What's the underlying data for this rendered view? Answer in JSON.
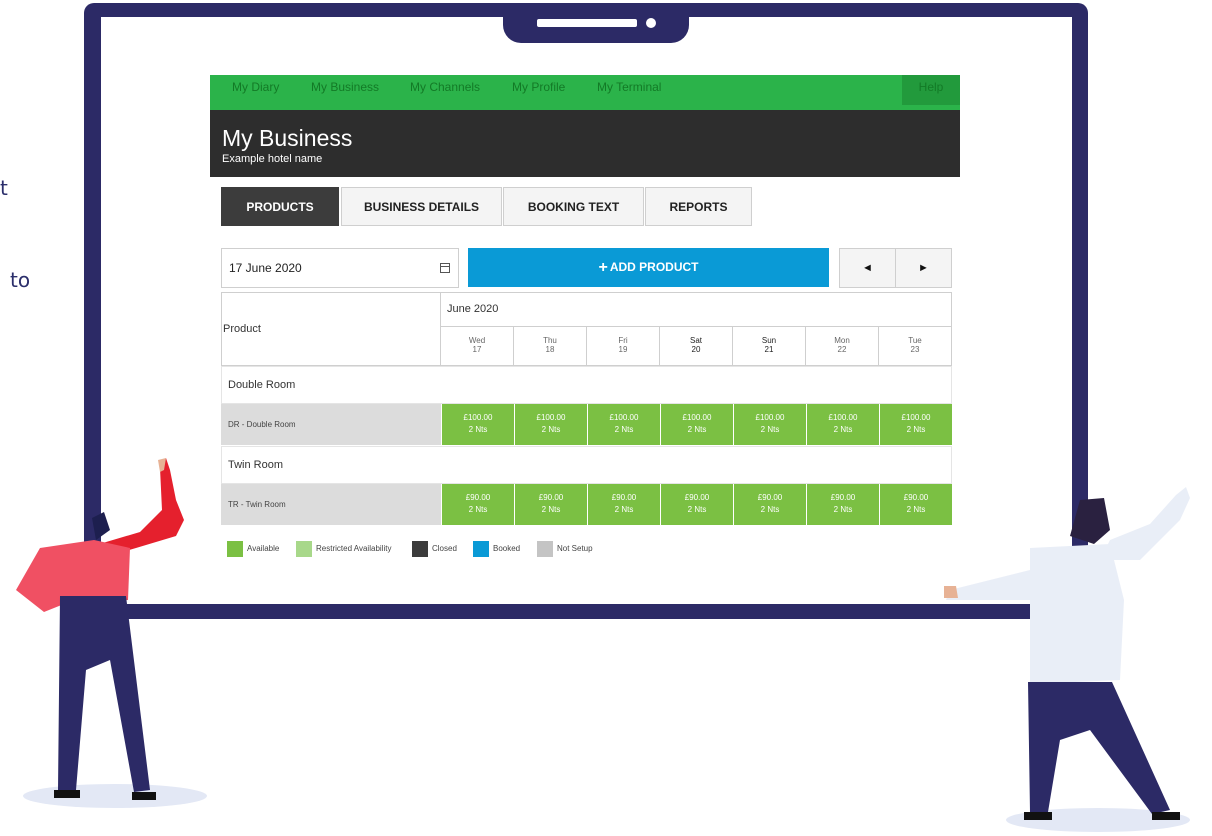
{
  "edge_texts": [
    "t",
    "to"
  ],
  "nav": {
    "items": [
      "My Diary",
      "My Business",
      "My Channels",
      "My Profile",
      "My Terminal"
    ],
    "help": "Help"
  },
  "header": {
    "title": "My Business",
    "subtitle": "Example hotel name"
  },
  "tabs": [
    "PRODUCTS",
    "BUSINESS DETAILS",
    "BOOKING TEXT",
    "REPORTS"
  ],
  "toolbar": {
    "date_value": "17 June 2020",
    "add_label": "ADD PRODUCT",
    "add_icon": "+",
    "prev_icon": "◄",
    "next_icon": "►"
  },
  "grid": {
    "product_header": "Product",
    "month": "June 2020",
    "days": [
      {
        "dow": "Wed",
        "date": "17"
      },
      {
        "dow": "Thu",
        "date": "18"
      },
      {
        "dow": "Fri",
        "date": "19"
      },
      {
        "dow": "Sat",
        "date": "20"
      },
      {
        "dow": "Sun",
        "date": "21"
      },
      {
        "dow": "Mon",
        "date": "22"
      },
      {
        "dow": "Tue",
        "date": "23"
      }
    ],
    "sections": [
      {
        "name": "Double Room",
        "room": "DR - Double Room",
        "rates": [
          {
            "price": "£100.00",
            "nights": "2 Nts"
          },
          {
            "price": "£100.00",
            "nights": "2 Nts"
          },
          {
            "price": "£100.00",
            "nights": "2 Nts"
          },
          {
            "price": "£100.00",
            "nights": "2 Nts"
          },
          {
            "price": "£100.00",
            "nights": "2 Nts"
          },
          {
            "price": "£100.00",
            "nights": "2 Nts"
          },
          {
            "price": "£100.00",
            "nights": "2 Nts"
          }
        ]
      },
      {
        "name": "Twin Room",
        "room": "TR - Twin Room",
        "rates": [
          {
            "price": "£90.00",
            "nights": "2 Nts"
          },
          {
            "price": "£90.00",
            "nights": "2 Nts"
          },
          {
            "price": "£90.00",
            "nights": "2 Nts"
          },
          {
            "price": "£90.00",
            "nights": "2 Nts"
          },
          {
            "price": "£90.00",
            "nights": "2 Nts"
          },
          {
            "price": "£90.00",
            "nights": "2 Nts"
          },
          {
            "price": "£90.00",
            "nights": "2 Nts"
          }
        ]
      }
    ]
  },
  "legend": [
    {
      "label": "Available",
      "color": "#7bc043"
    },
    {
      "label": "Restricted Availability",
      "color": "#a8d88a"
    },
    {
      "label": "Closed",
      "color": "#3c3c3c"
    },
    {
      "label": "Booked",
      "color": "#0a9ad6"
    },
    {
      "label": "Not Setup",
      "color": "#c4c4c4"
    }
  ]
}
